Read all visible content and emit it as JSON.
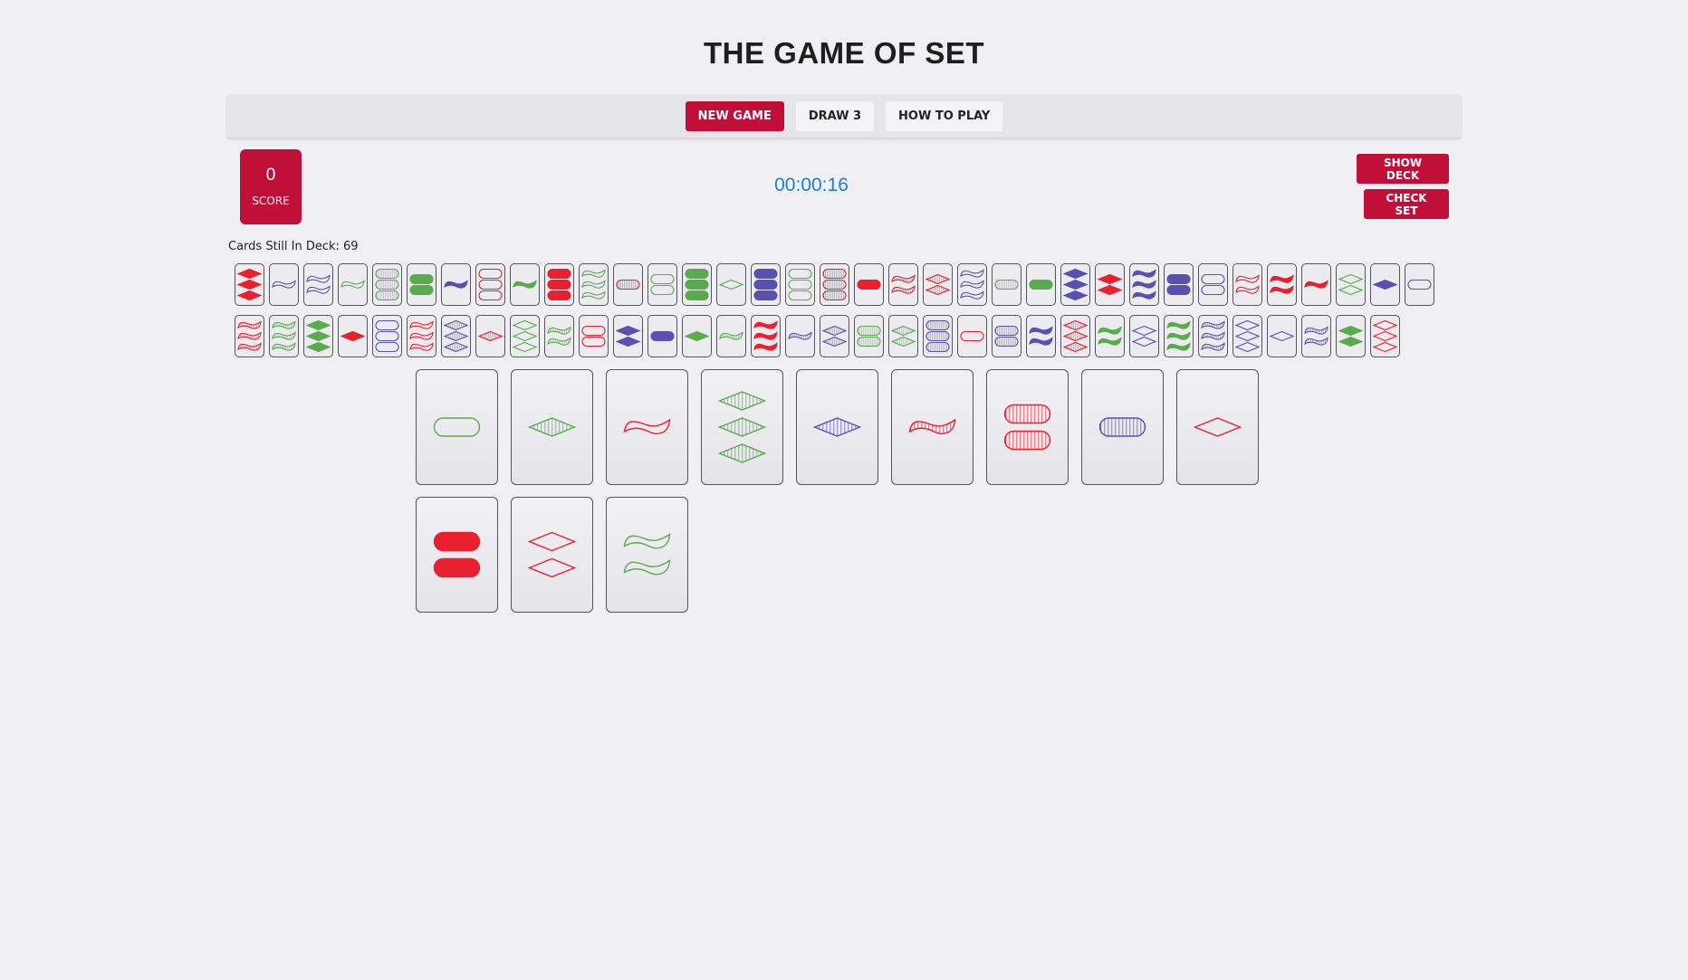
{
  "title": "THE GAME OF SET",
  "nav": {
    "new_game": "NEW GAME",
    "draw3": "DRAW 3",
    "how_to_play": "HOW TO PLAY"
  },
  "score": {
    "value": "0",
    "label": "SCORE"
  },
  "timer": "00:00:16",
  "buttons": {
    "show_deck": "SHOW DECK",
    "check_set": "CHECK SET"
  },
  "deck_count_label": "Cards Still In Deck: 69",
  "colors": {
    "red": "#e8202f",
    "green": "#5aaa4e",
    "purple": "#5a50b0",
    "accent": "#c0103a",
    "timer": "#1a7fd6"
  },
  "deck_rows": [
    [
      {
        "n": 3,
        "shape": "diamond",
        "color": "red",
        "fill": "solid"
      },
      {
        "n": 1,
        "shape": "squiggle",
        "color": "purple",
        "fill": "open"
      },
      {
        "n": 2,
        "shape": "squiggle",
        "color": "purple",
        "fill": "open"
      },
      {
        "n": 1,
        "shape": "squiggle",
        "color": "green",
        "fill": "open"
      },
      {
        "n": 3,
        "shape": "oval",
        "color": "green",
        "fill": "striped"
      },
      {
        "n": 2,
        "shape": "oval",
        "color": "green",
        "fill": "solid"
      },
      {
        "n": 1,
        "shape": "squiggle",
        "color": "purple",
        "fill": "solid"
      },
      {
        "n": 3,
        "shape": "oval",
        "color": "red",
        "fill": "open"
      },
      {
        "n": 1,
        "shape": "squiggle",
        "color": "green",
        "fill": "solid"
      },
      {
        "n": 3,
        "shape": "oval",
        "color": "red",
        "fill": "solid"
      },
      {
        "n": 3,
        "shape": "squiggle",
        "color": "green",
        "fill": "open"
      },
      {
        "n": 1,
        "shape": "oval",
        "color": "red",
        "fill": "striped"
      },
      {
        "n": 2,
        "shape": "oval",
        "color": "green",
        "fill": "open"
      },
      {
        "n": 3,
        "shape": "oval",
        "color": "green",
        "fill": "solid"
      },
      {
        "n": 1,
        "shape": "diamond",
        "color": "green",
        "fill": "open"
      },
      {
        "n": 3,
        "shape": "oval",
        "color": "purple",
        "fill": "solid"
      },
      {
        "n": 3,
        "shape": "oval",
        "color": "green",
        "fill": "open"
      },
      {
        "n": 3,
        "shape": "oval",
        "color": "red",
        "fill": "striped"
      },
      {
        "n": 1,
        "shape": "oval",
        "color": "red",
        "fill": "solid"
      },
      {
        "n": 2,
        "shape": "squiggle",
        "color": "red",
        "fill": "striped"
      },
      {
        "n": 2,
        "shape": "diamond",
        "color": "red",
        "fill": "striped"
      },
      {
        "n": 3,
        "shape": "squiggle",
        "color": "purple",
        "fill": "open"
      },
      {
        "n": 1,
        "shape": "oval",
        "color": "green",
        "fill": "striped"
      },
      {
        "n": 1,
        "shape": "oval",
        "color": "green",
        "fill": "solid"
      },
      {
        "n": 3,
        "shape": "diamond",
        "color": "purple",
        "fill": "solid"
      },
      {
        "n": 2,
        "shape": "diamond",
        "color": "red",
        "fill": "solid"
      },
      {
        "n": 3,
        "shape": "squiggle",
        "color": "purple",
        "fill": "solid"
      },
      {
        "n": 2,
        "shape": "oval",
        "color": "purple",
        "fill": "solid"
      },
      {
        "n": 2,
        "shape": "oval",
        "color": "purple",
        "fill": "open"
      },
      {
        "n": 2,
        "shape": "squiggle",
        "color": "red",
        "fill": "open"
      },
      {
        "n": 2,
        "shape": "squiggle",
        "color": "red",
        "fill": "solid"
      },
      {
        "n": 1,
        "shape": "squiggle",
        "color": "red",
        "fill": "solid"
      },
      {
        "n": 2,
        "shape": "diamond",
        "color": "green",
        "fill": "open"
      },
      {
        "n": 1,
        "shape": "diamond",
        "color": "purple",
        "fill": "solid"
      },
      {
        "n": 1,
        "shape": "oval",
        "color": "purple",
        "fill": "open"
      }
    ],
    [
      {
        "n": 3,
        "shape": "squiggle",
        "color": "red",
        "fill": "striped"
      },
      {
        "n": 3,
        "shape": "squiggle",
        "color": "green",
        "fill": "striped"
      },
      {
        "n": 3,
        "shape": "diamond",
        "color": "green",
        "fill": "solid"
      },
      {
        "n": 1,
        "shape": "diamond",
        "color": "red",
        "fill": "solid"
      },
      {
        "n": 3,
        "shape": "oval",
        "color": "purple",
        "fill": "open"
      },
      {
        "n": 3,
        "shape": "squiggle",
        "color": "red",
        "fill": "open"
      },
      {
        "n": 3,
        "shape": "diamond",
        "color": "purple",
        "fill": "striped"
      },
      {
        "n": 1,
        "shape": "diamond",
        "color": "red",
        "fill": "striped"
      },
      {
        "n": 3,
        "shape": "diamond",
        "color": "green",
        "fill": "open"
      },
      {
        "n": 2,
        "shape": "squiggle",
        "color": "green",
        "fill": "striped"
      },
      {
        "n": 2,
        "shape": "oval",
        "color": "red",
        "fill": "open"
      },
      {
        "n": 2,
        "shape": "diamond",
        "color": "purple",
        "fill": "solid"
      },
      {
        "n": 1,
        "shape": "oval",
        "color": "purple",
        "fill": "solid"
      },
      {
        "n": 1,
        "shape": "diamond",
        "color": "green",
        "fill": "solid"
      },
      {
        "n": 1,
        "shape": "squiggle",
        "color": "green",
        "fill": "striped"
      },
      {
        "n": 3,
        "shape": "squiggle",
        "color": "red",
        "fill": "solid"
      },
      {
        "n": 1,
        "shape": "squiggle",
        "color": "purple",
        "fill": "striped"
      },
      {
        "n": 2,
        "shape": "diamond",
        "color": "purple",
        "fill": "striped"
      },
      {
        "n": 2,
        "shape": "oval",
        "color": "green",
        "fill": "striped"
      },
      {
        "n": 2,
        "shape": "diamond",
        "color": "green",
        "fill": "striped"
      },
      {
        "n": 3,
        "shape": "oval",
        "color": "purple",
        "fill": "striped"
      },
      {
        "n": 1,
        "shape": "oval",
        "color": "red",
        "fill": "open"
      },
      {
        "n": 2,
        "shape": "oval",
        "color": "purple",
        "fill": "striped"
      },
      {
        "n": 2,
        "shape": "squiggle",
        "color": "purple",
        "fill": "solid"
      },
      {
        "n": 3,
        "shape": "diamond",
        "color": "red",
        "fill": "striped"
      },
      {
        "n": 2,
        "shape": "squiggle",
        "color": "green",
        "fill": "solid"
      },
      {
        "n": 2,
        "shape": "diamond",
        "color": "purple",
        "fill": "open"
      },
      {
        "n": 3,
        "shape": "squiggle",
        "color": "green",
        "fill": "solid"
      },
      {
        "n": 3,
        "shape": "squiggle",
        "color": "purple",
        "fill": "striped"
      },
      {
        "n": 3,
        "shape": "diamond",
        "color": "purple",
        "fill": "open"
      },
      {
        "n": 1,
        "shape": "diamond",
        "color": "purple",
        "fill": "open"
      },
      {
        "n": 2,
        "shape": "squiggle",
        "color": "purple",
        "fill": "striped"
      },
      {
        "n": 2,
        "shape": "diamond",
        "color": "green",
        "fill": "solid"
      },
      {
        "n": 3,
        "shape": "diamond",
        "color": "red",
        "fill": "open"
      }
    ]
  ],
  "board_rows": [
    [
      {
        "n": 1,
        "shape": "oval",
        "color": "green",
        "fill": "open"
      },
      {
        "n": 1,
        "shape": "diamond",
        "color": "green",
        "fill": "striped"
      },
      {
        "n": 1,
        "shape": "squiggle",
        "color": "red",
        "fill": "open"
      },
      {
        "n": 3,
        "shape": "diamond",
        "color": "green",
        "fill": "striped"
      },
      {
        "n": 1,
        "shape": "diamond",
        "color": "purple",
        "fill": "striped"
      },
      {
        "n": 1,
        "shape": "squiggle",
        "color": "red",
        "fill": "striped"
      },
      {
        "n": 2,
        "shape": "oval",
        "color": "red",
        "fill": "striped"
      },
      {
        "n": 1,
        "shape": "oval",
        "color": "purple",
        "fill": "striped"
      },
      {
        "n": 1,
        "shape": "diamond",
        "color": "red",
        "fill": "open"
      }
    ],
    [
      {
        "n": 2,
        "shape": "oval",
        "color": "red",
        "fill": "solid"
      },
      {
        "n": 2,
        "shape": "diamond",
        "color": "red",
        "fill": "open"
      },
      {
        "n": 2,
        "shape": "squiggle",
        "color": "green",
        "fill": "open"
      }
    ]
  ]
}
